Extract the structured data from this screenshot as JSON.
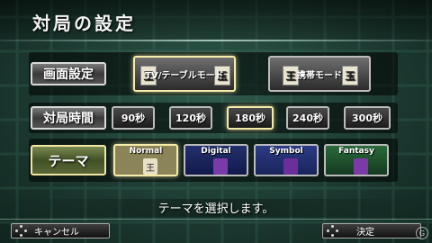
{
  "header": {
    "title": "対局の設定"
  },
  "rows": {
    "screen": {
      "label": "画面設定",
      "options": [
        {
          "label": "TV/テーブルモード",
          "selected": true
        },
        {
          "label": "携帯モード",
          "selected": false
        }
      ]
    },
    "time": {
      "label": "対局時間",
      "options": [
        "90秒",
        "120秒",
        "180秒",
        "240秒",
        "300秒"
      ],
      "selected_index": 2
    },
    "theme": {
      "label": "テーマ",
      "options": [
        {
          "label": "Normal",
          "bg": "#8a8458",
          "tile": "王"
        },
        {
          "label": "Digital",
          "bg": "#1c2a6e",
          "tile": ""
        },
        {
          "label": "Symbol",
          "bg": "#2a3a7a",
          "tile": ""
        },
        {
          "label": "Fantasy",
          "bg": "#1f4a2c",
          "tile": ""
        }
      ],
      "selected_index": 0
    }
  },
  "status": {
    "message": "テーマを選択します。"
  },
  "footer": {
    "cancel_label": "キャンセル",
    "confirm_label": "決定"
  },
  "mode_tiles": {
    "left": "王",
    "right": "玉"
  },
  "colors": {
    "highlight": "#f6ecaa",
    "background": "#1d3b32"
  }
}
